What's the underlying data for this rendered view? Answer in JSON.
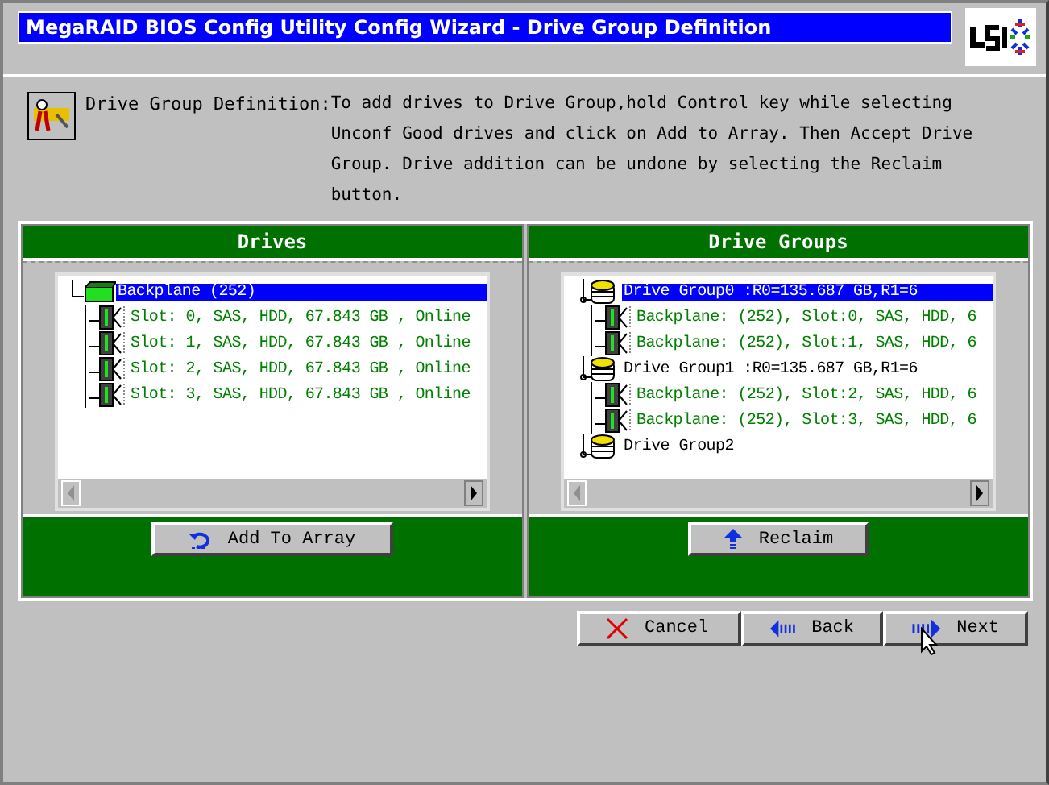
{
  "window": {
    "title": "MegaRAID BIOS Config Utility  Config Wizard - Drive Group Definition"
  },
  "description": {
    "label": "Drive Group Definition:",
    "text": "To add drives to Drive Group,hold Control key while selecting Unconf Good drives and click on Add to Array. Then Accept Drive Group. Drive addition can be undone by selecting the Reclaim button."
  },
  "panels": [
    {
      "title": "Drives",
      "button": {
        "label": "Add To Array",
        "kind": "add"
      },
      "tree": [
        {
          "label": "Backplane (252)",
          "kind": "backplane",
          "selected": true,
          "children": [
            {
              "label": "Slot: 0, SAS, HDD, 67.843 GB , Online",
              "kind": "drive",
              "selected": false
            },
            {
              "label": "Slot: 1, SAS, HDD, 67.843 GB , Online",
              "kind": "drive",
              "selected": false
            },
            {
              "label": "Slot: 2, SAS, HDD, 67.843 GB , Online",
              "kind": "drive",
              "selected": false
            },
            {
              "label": "Slot: 3, SAS, HDD, 67.843 GB , Online",
              "kind": "drive",
              "selected": false
            }
          ]
        }
      ]
    },
    {
      "title": "Drive Groups",
      "button": {
        "label": "Reclaim",
        "kind": "reclaim"
      },
      "tree": [
        {
          "label": "Drive Group0 :R0=135.687 GB,R1=6",
          "kind": "group",
          "selected": true,
          "children": [
            {
              "label": "Backplane: (252), Slot:0, SAS, HDD, 6",
              "kind": "drive",
              "selected": false
            },
            {
              "label": "Backplane: (252), Slot:1, SAS, HDD, 6",
              "kind": "drive",
              "selected": false
            }
          ]
        },
        {
          "label": "Drive Group1 :R0=135.687 GB,R1=6",
          "kind": "group",
          "selected": false,
          "children": [
            {
              "label": "Backplane: (252), Slot:2, SAS, HDD, 6",
              "kind": "drive",
              "selected": false
            },
            {
              "label": "Backplane: (252), Slot:3, SAS, HDD, 6",
              "kind": "drive",
              "selected": false
            }
          ]
        },
        {
          "label": "Drive Group2",
          "kind": "group",
          "selected": false
        }
      ]
    }
  ],
  "buttons": [
    {
      "label": "Cancel",
      "kind": "cancel"
    },
    {
      "label": "Back",
      "kind": "back"
    },
    {
      "label": "Next",
      "kind": "next"
    }
  ]
}
